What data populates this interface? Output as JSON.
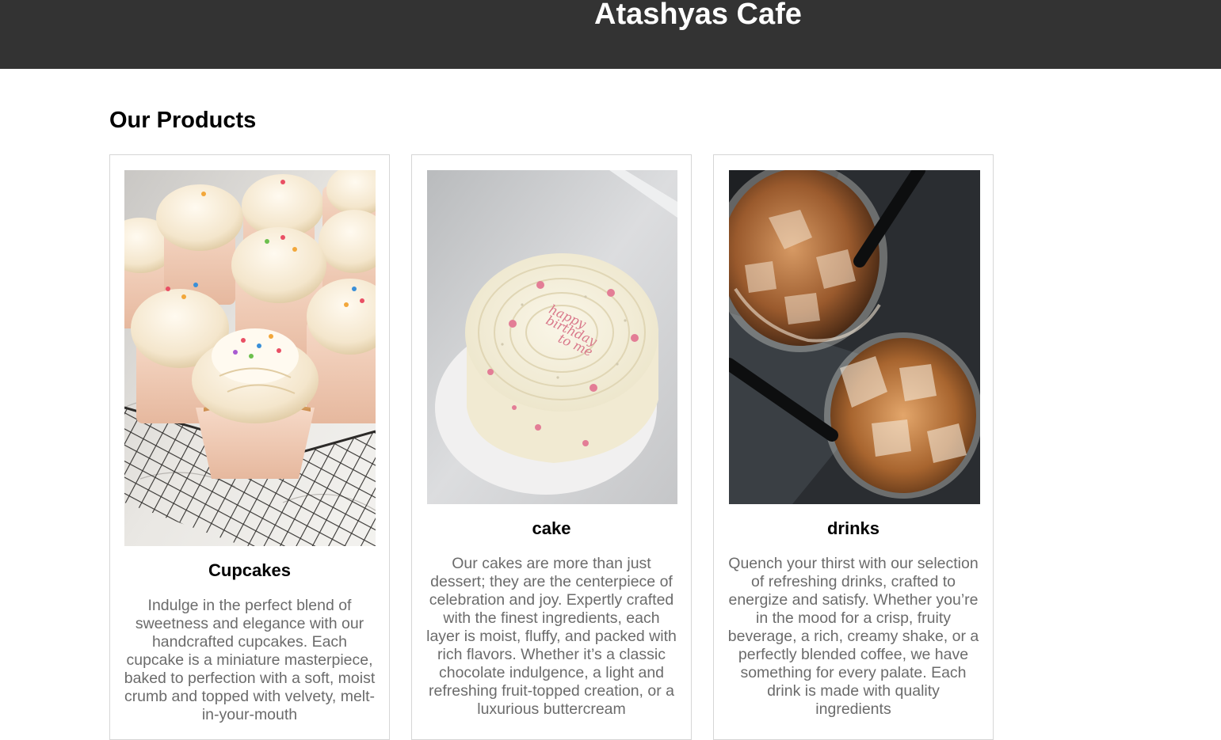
{
  "header": {
    "title": "Atashyas Cafe",
    "bg_color": "#333333"
  },
  "main": {
    "section_title": "Our Products",
    "products": [
      {
        "name": "Cupcakes",
        "image": "cupcakes-photo",
        "description": "Indulge in the perfect blend of sweetness and elegance with our handcrafted cupcakes. Each cupcake is a miniature masterpiece, baked to perfection with a soft, moist crumb and topped with velvety, melt-in-your-mouth"
      },
      {
        "name": "cake",
        "image": "cake-photo",
        "description": "Our cakes are more than just dessert; they are the centerpiece of celebration and joy. Expertly crafted with the finest ingredients, each layer is moist, fluffy, and packed with rich flavors. Whether it’s a classic chocolate indulgence, a light and refreshing fruit-topped creation, or a luxurious buttercream"
      },
      {
        "name": "drinks",
        "image": "iced-coffee-photo",
        "description": "Quench your thirst with our selection of refreshing drinks, crafted to energize and satisfy. Whether you’re in the mood for a crisp, fruity beverage, a rich, creamy shake, or a perfectly blended coffee, we have something for every palate. Each drink is made with quality ingredients"
      }
    ]
  }
}
